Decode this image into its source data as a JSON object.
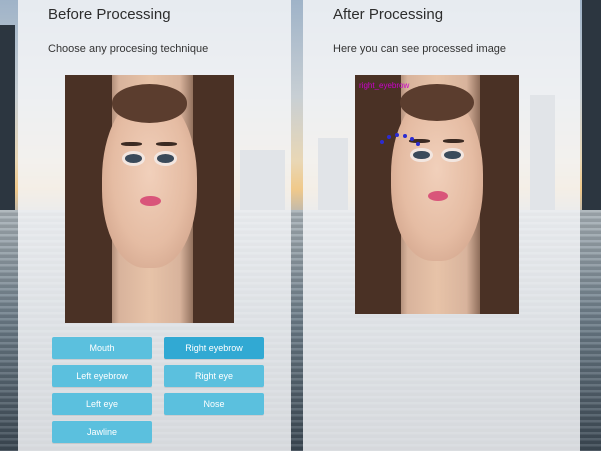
{
  "left_panel": {
    "title": "Before Processing",
    "subtitle": "Choose any procesing technique",
    "buttons": [
      {
        "label": "Mouth",
        "active": false
      },
      {
        "label": "Right eyebrow",
        "active": true
      },
      {
        "label": "Left eyebrow",
        "active": false
      },
      {
        "label": "Right eye",
        "active": false
      },
      {
        "label": "Left eye",
        "active": false
      },
      {
        "label": "Nose",
        "active": false
      },
      {
        "label": "Jawline",
        "active": false
      }
    ]
  },
  "right_panel": {
    "title": "After Processing",
    "subtitle": "Here you can see processed image",
    "overlay_label": "right_eyebrow"
  },
  "colors": {
    "button": "#5bc0de",
    "button_active": "#31a9d3",
    "landmark_dot": "#2b2bd1",
    "overlay_label": "#cc00cc"
  }
}
